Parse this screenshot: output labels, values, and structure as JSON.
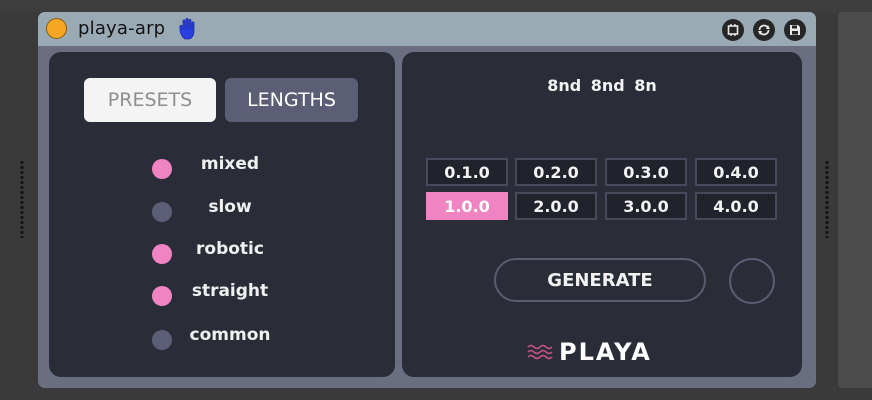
{
  "device": {
    "title": "playa-arp",
    "icons": {
      "power": "power-dot-icon",
      "hand": "hand-icon",
      "freeze": "freeze-icon",
      "refresh": "refresh-icon",
      "save": "save-icon"
    },
    "colors": {
      "accent": "#f083c2",
      "power": "#f5a623",
      "hand": "#2a3fe0"
    }
  },
  "tabs": [
    {
      "label": "PRESETS",
      "active": false
    },
    {
      "label": "LENGTHS",
      "active": true
    }
  ],
  "presets": [
    {
      "label": "mixed",
      "on": true
    },
    {
      "label": "slow",
      "on": false
    },
    {
      "label": "robotic",
      "on": true
    },
    {
      "label": "straight",
      "on": true
    },
    {
      "label": "common",
      "on": false
    }
  ],
  "lengths": {
    "display": "8nd 8nd 8n",
    "grid": [
      [
        "0.1.0",
        "0.2.0",
        "0.3.0",
        "0.4.0"
      ],
      [
        "1.0.0",
        "2.0.0",
        "3.0.0",
        "4.0.0"
      ]
    ],
    "selected": "1.0.0"
  },
  "generate_label": "GENERATE",
  "brand": "PLAYA"
}
